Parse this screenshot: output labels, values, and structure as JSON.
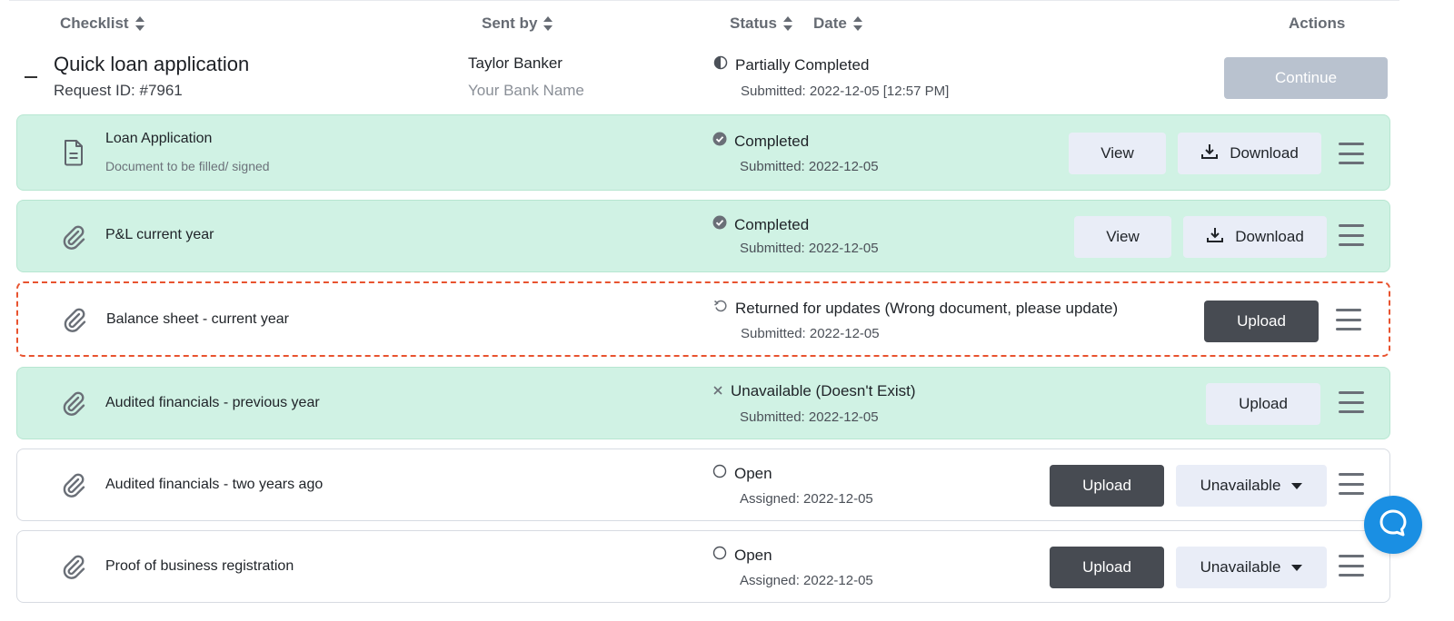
{
  "header": {
    "checklist": "Checklist",
    "sent_by": "Sent by",
    "status": "Status",
    "date": "Date",
    "actions": "Actions"
  },
  "request": {
    "title": "Quick loan application",
    "request_id": "Request ID: #7961",
    "sender_name": "Taylor Banker",
    "sender_org": "Your Bank Name",
    "status": "Partially Completed",
    "submitted": "Submitted: 2022-12-05 [12:57 PM]",
    "continue_label": "Continue"
  },
  "items": [
    {
      "name": "Loan Application",
      "subtitle": "Document to be filled/ signed",
      "icon": "document-icon",
      "status": "Completed",
      "status_icon": "check-circle-icon",
      "date": "Submitted: 2022-12-05",
      "view_label": "View",
      "download_label": "Download"
    },
    {
      "name": "P&L current year",
      "icon": "paperclip-icon",
      "status": "Completed",
      "status_icon": "check-circle-icon",
      "date": "Submitted: 2022-12-05",
      "view_label": "View",
      "download_label": "Download"
    },
    {
      "name": "Balance sheet - current year",
      "icon": "paperclip-icon",
      "status": "Returned for updates (Wrong document, please update)",
      "status_icon": "undo-icon",
      "date": "Submitted: 2022-12-05",
      "upload_label": "Upload"
    },
    {
      "name": "Audited financials - previous year",
      "icon": "paperclip-icon",
      "status": "Unavailable (Doesn't Exist)",
      "status_icon": "x-icon",
      "date": "Submitted: 2022-12-05",
      "upload_label": "Upload"
    },
    {
      "name": "Audited financials - two years ago",
      "icon": "paperclip-icon",
      "status": "Open",
      "status_icon": "empty-circle-icon",
      "date": "Assigned: 2022-12-05",
      "upload_label": "Upload",
      "unavailable_label": "Unavailable"
    },
    {
      "name": "Proof of business registration",
      "icon": "paperclip-icon",
      "status": "Open",
      "status_icon": "empty-circle-icon",
      "date": "Assigned: 2022-12-05",
      "upload_label": "Upload",
      "unavailable_label": "Unavailable"
    }
  ],
  "colors": {
    "completed_bg": "#d0f2e4",
    "returned_border": "#e8532f",
    "dark_button": "#474b52",
    "light_button": "#e9edf7",
    "continue_disabled": "#b9c2cf",
    "chat_blue": "#1a8fe3"
  }
}
